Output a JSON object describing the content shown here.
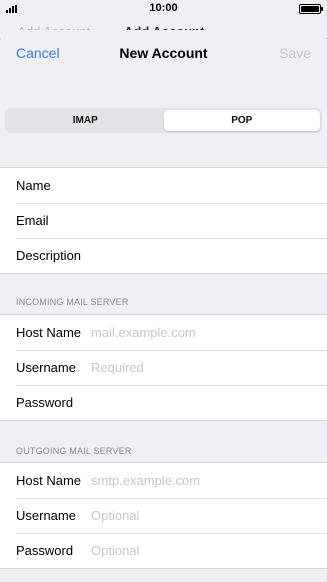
{
  "status_bar": {
    "time": "10:00",
    "battery_level": 1.0
  },
  "behind": {
    "back_label": "Add Account",
    "title": "Add Account"
  },
  "nav": {
    "cancel": "Cancel",
    "title": "New Account",
    "save": "Save"
  },
  "segments": {
    "imap": "IMAP",
    "pop": "POP",
    "selected": "POP"
  },
  "account": {
    "name_label": "Name",
    "email_label": "Email",
    "description_label": "Description"
  },
  "incoming": {
    "header": "INCOMING MAIL SERVER",
    "host_label": "Host Name",
    "host_placeholder": "mail.example.com",
    "username_label": "Username",
    "username_placeholder": "Required",
    "password_label": "Password"
  },
  "outgoing": {
    "header": "OUTGOING MAIL SERVER",
    "host_label": "Host Name",
    "host_placeholder": "smtp.example.com",
    "username_label": "Username",
    "username_placeholder": "Optional",
    "password_label": "Password",
    "password_placeholder": "Optional"
  },
  "colors": {
    "accent": "#2f7cf6",
    "disabled": "#c4c4c8",
    "background": "#efeff4"
  }
}
